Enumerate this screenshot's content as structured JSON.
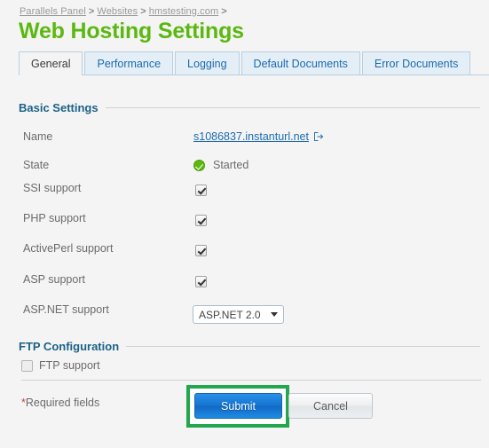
{
  "breadcrumb": {
    "items": [
      {
        "label": "Parallels Panel"
      },
      {
        "label": "Websites"
      },
      {
        "label": "hmstesting.com"
      }
    ],
    "separator": ">"
  },
  "page": {
    "title": "Web Hosting Settings",
    "title_color": "#5cb811",
    "background": "#f4f4f4"
  },
  "tabs": [
    {
      "label": "General",
      "active": true
    },
    {
      "label": "Performance",
      "active": false
    },
    {
      "label": "Logging",
      "active": false
    },
    {
      "label": "Default Documents",
      "active": false
    },
    {
      "label": "Error Documents",
      "active": false
    }
  ],
  "sections": {
    "basic": {
      "title": "Basic Settings",
      "rows": {
        "name": {
          "label": "Name",
          "value": "s1086837.instanturl.net",
          "icon": "external-link-icon",
          "link_color": "#1c6ab0"
        },
        "state": {
          "label": "State",
          "value": "Started",
          "icon": "status-ok-icon",
          "status_color": "#5cb811"
        },
        "ssi": {
          "label": "SSI support",
          "checked": "checked"
        },
        "php": {
          "label": "PHP support",
          "checked": "checked"
        },
        "activeperl": {
          "label": "ActivePerl support",
          "checked": "checked"
        },
        "asp": {
          "label": "ASP support",
          "checked": "checked"
        },
        "aspnet": {
          "label": "ASP.NET support",
          "selected": "ASP.NET 2.0",
          "options": [
            "ASP.NET 2.0"
          ]
        }
      }
    },
    "ftp": {
      "title": "FTP Configuration",
      "support": {
        "label": "FTP support",
        "checked": "unchecked"
      }
    }
  },
  "footer": {
    "required_star": "*",
    "required_text": "Required fields",
    "submit_label": "Submit",
    "cancel_label": "Cancel",
    "highlight_color": "#22a74f"
  }
}
